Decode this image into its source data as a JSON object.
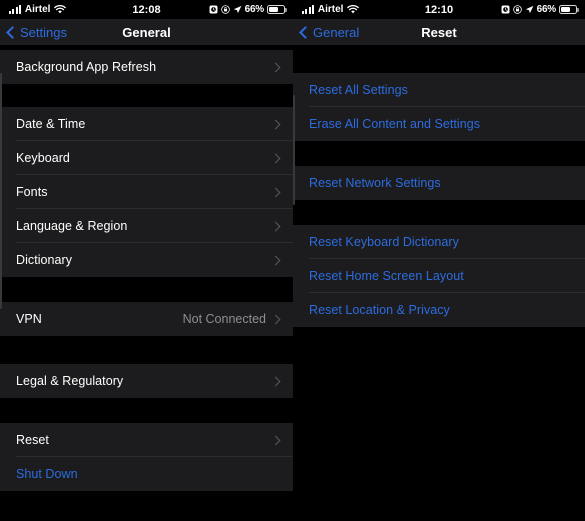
{
  "left": {
    "status_bar": {
      "carrier": "Airtel",
      "time": "12:08",
      "battery_percent": "66%",
      "icons": [
        "signal-bars-icon",
        "wifi-icon",
        "alarm-clock-icon",
        "orientation-lock-icon",
        "location-arrow-icon",
        "battery-icon"
      ]
    },
    "nav": {
      "back_label": "Settings",
      "title": "General"
    },
    "sections": [
      {
        "rows": [
          {
            "label": "Background App Refresh",
            "accessory": "chevron",
            "style": "normal"
          }
        ]
      },
      {
        "rows": [
          {
            "label": "Date & Time",
            "accessory": "chevron",
            "style": "normal"
          },
          {
            "label": "Keyboard",
            "accessory": "chevron",
            "style": "normal"
          },
          {
            "label": "Fonts",
            "accessory": "chevron",
            "style": "normal"
          },
          {
            "label": "Language & Region",
            "accessory": "chevron",
            "style": "normal"
          },
          {
            "label": "Dictionary",
            "accessory": "chevron",
            "style": "normal"
          }
        ]
      },
      {
        "rows": [
          {
            "label": "VPN",
            "value": "Not Connected",
            "accessory": "chevron",
            "style": "normal"
          }
        ]
      },
      {
        "rows": [
          {
            "label": "Legal & Regulatory",
            "accessory": "chevron",
            "style": "normal"
          }
        ]
      },
      {
        "rows": [
          {
            "label": "Reset",
            "accessory": "chevron",
            "style": "normal"
          },
          {
            "label": "Shut Down",
            "accessory": "none",
            "style": "link"
          }
        ]
      }
    ]
  },
  "right": {
    "status_bar": {
      "carrier": "Airtel",
      "time": "12:10",
      "battery_percent": "66%",
      "icons": [
        "signal-bars-icon",
        "wifi-icon",
        "alarm-clock-icon",
        "orientation-lock-icon",
        "location-arrow-icon",
        "battery-icon"
      ]
    },
    "nav": {
      "back_label": "General",
      "title": "Reset"
    },
    "sections": [
      {
        "rows": [
          {
            "label": "Reset All Settings",
            "accessory": "none",
            "style": "link"
          },
          {
            "label": "Erase All Content and Settings",
            "accessory": "none",
            "style": "link"
          }
        ]
      },
      {
        "rows": [
          {
            "label": "Reset Network Settings",
            "accessory": "none",
            "style": "link"
          }
        ]
      },
      {
        "rows": [
          {
            "label": "Reset Keyboard Dictionary",
            "accessory": "none",
            "style": "link"
          },
          {
            "label": "Reset Home Screen Layout",
            "accessory": "none",
            "style": "link"
          },
          {
            "label": "Reset Location & Privacy",
            "accessory": "none",
            "style": "link"
          }
        ]
      }
    ]
  },
  "colors": {
    "accent_blue": "#2d6cdf",
    "row_background": "#1c1c1e",
    "page_background": "#000000",
    "separator": "#2c2c2e",
    "secondary_text": "#8e8e93"
  }
}
